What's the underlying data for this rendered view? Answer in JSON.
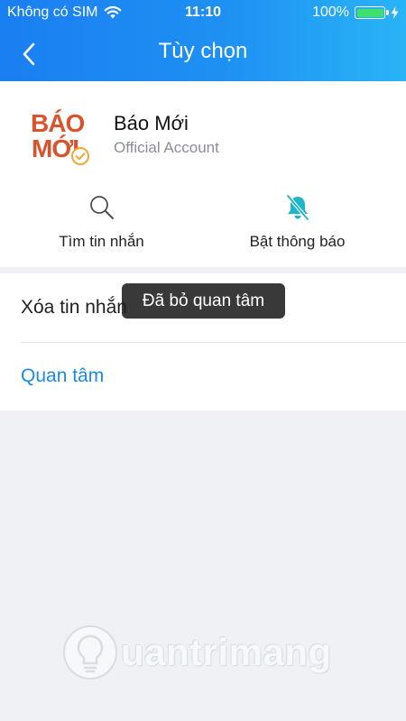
{
  "status_bar": {
    "carrier": "Không có SIM",
    "time": "11:10",
    "battery": "100%",
    "battery_level": 1.0
  },
  "nav": {
    "title": "Tùy chọn",
    "back_icon": "chevron-left-icon"
  },
  "account": {
    "name": "Báo Mới",
    "type": "Official Account",
    "logo_line1": "BÁO",
    "logo_line2": "MỚI",
    "logo_color": "#d9542c"
  },
  "actions": [
    {
      "label": "Tìm tin nhắn",
      "icon": "search-icon"
    },
    {
      "label": "Bật thông báo",
      "icon": "bell-off-icon"
    }
  ],
  "list": [
    {
      "label": "Xóa tin nhắn"
    },
    {
      "label": "Quan tâm"
    }
  ],
  "toast": {
    "message": "Đã bỏ quan tâm"
  },
  "watermark": {
    "text": "uantrimang"
  },
  "colors": {
    "header_start": "#1a7ff1",
    "header_end": "#29b4f6",
    "accent": "#1c89e8",
    "bell_icon": "#1fb5c9"
  }
}
